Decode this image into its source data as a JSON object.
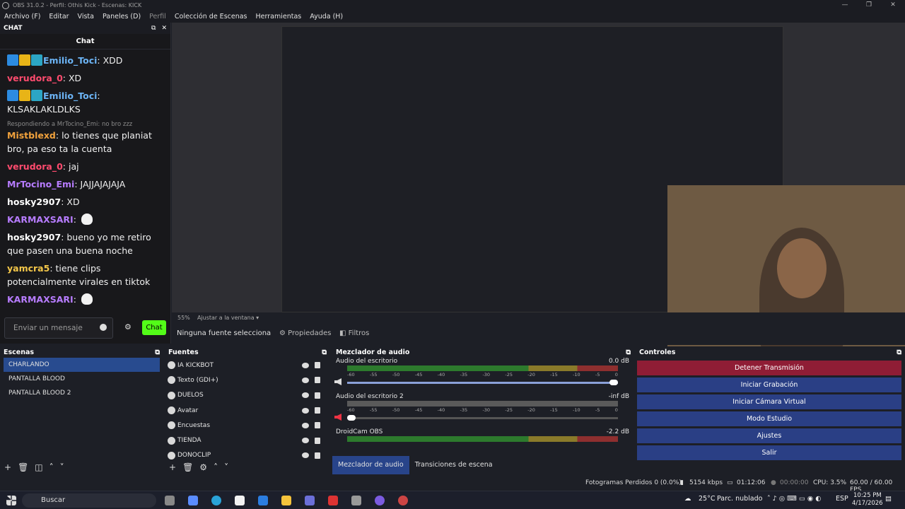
{
  "window": {
    "title": "OBS 31.0.2 - Perfil: Othis Kick - Escenas: KICK"
  },
  "menu": [
    {
      "label": "Archivo (F)",
      "dim": false
    },
    {
      "label": "Editar",
      "dim": false
    },
    {
      "label": "Vista",
      "dim": false
    },
    {
      "label": "Paneles (D)",
      "dim": false
    },
    {
      "label": "Perfil",
      "dim": true
    },
    {
      "label": "Colección de Escenas",
      "dim": false
    },
    {
      "label": "Herramientas",
      "dim": false
    },
    {
      "label": "Ayuda (H)",
      "dim": false
    }
  ],
  "chat": {
    "dock_title": "CHAT",
    "title": "Chat",
    "input_placeholder": "Enviar un mensaje",
    "send_label": "Chat",
    "messages": [
      {
        "user": "Emilio_Toci",
        "color": "#6cb4f5",
        "text": "XDD",
        "badges": true
      },
      {
        "user": "verudora_0",
        "color": "#ff4b6e",
        "text": "XD"
      },
      {
        "user": "Emilio_Toci",
        "color": "#6cb4f5",
        "text": "KLSAKLAKLDLKS",
        "badges": true
      },
      {
        "reply": "Respondiendo a MrTocino_Emi: no bro zzz",
        "user": "Mistblexd",
        "color": "#f0a13c",
        "text": "lo tienes que planiat bro, pa eso ta la cuenta"
      },
      {
        "user": "verudora_0",
        "color": "#ff4b6e",
        "text": "jaj"
      },
      {
        "user": "MrTocino_Emi",
        "color": "#b77cff",
        "text": "JAJJAJAJAJA"
      },
      {
        "user": "hosky2907",
        "color": "#ffffff",
        "text": "XD"
      },
      {
        "user": "KARMAXSARI",
        "color": "#b77cff",
        "text": "",
        "goose": true
      },
      {
        "user": "hosky2907",
        "color": "#ffffff",
        "text": "bueno yo me retiro que pasen una buena noche"
      },
      {
        "user": "yamcra5",
        "color": "#f5c84a",
        "text": "tiene clips potencialmente virales en tiktok"
      },
      {
        "user": "KARMAXSARI",
        "color": "#b77cff",
        "text": "",
        "goose": true
      }
    ]
  },
  "preview": {
    "zoom": "55%",
    "fit": "Ajustar a la ventana"
  },
  "source_bar": {
    "none": "Ninguna fuente selecciona",
    "properties": "Propiedades",
    "filters": "Filtros"
  },
  "scenes": {
    "title": "Escenas",
    "items": [
      "CHARLANDO",
      "PANTALLA BLOOD",
      "PANTALLA BLOOD 2"
    ],
    "selected": 0
  },
  "sources": {
    "title": "Fuentes",
    "items": [
      "IA KICKBOT",
      "Texto (GDI+)",
      "DUELOS",
      "Avatar",
      "Encuestas",
      "TIENDA",
      "DONOCLIP"
    ]
  },
  "mixer": {
    "title": "Mezclador de audio",
    "channels": [
      {
        "name": "Audio del escritorio",
        "db": "0.0 dB",
        "active": true
      },
      {
        "name": "Audio del escritorio 2",
        "db": "-inf dB",
        "active": false
      },
      {
        "name": "DroidCam OBS",
        "db": "-2.2 dB",
        "active": true
      }
    ],
    "scale": [
      "-60",
      "-55",
      "-50",
      "-45",
      "-40",
      "-35",
      "-30",
      "-25",
      "-20",
      "-15",
      "-10",
      "-5",
      "0"
    ],
    "tabs": [
      "Mezclador de audio",
      "Transiciones de escena"
    ]
  },
  "controls": {
    "title": "Controles",
    "buttons": [
      "Detener Transmisión",
      "Iniciar Grabación",
      "Iniciar Cámara Virtual",
      "Modo Estudio",
      "Ajustes",
      "Salir"
    ]
  },
  "status": {
    "dropped": "Fotogramas Perdidos 0 (0.0%)",
    "bitrate": "5154 kbps",
    "live_time": "01:12:06",
    "rec_time": "00:00:00",
    "cpu": "CPU: 3.5%",
    "fps": "60.00 / 60.00 FPS"
  },
  "taskbar": {
    "search": "Buscar",
    "weather": "25°C",
    "weather_text": "Parc. nublado",
    "lang": "ESP",
    "time": "10:25 PM",
    "date": "4/17/2026"
  }
}
